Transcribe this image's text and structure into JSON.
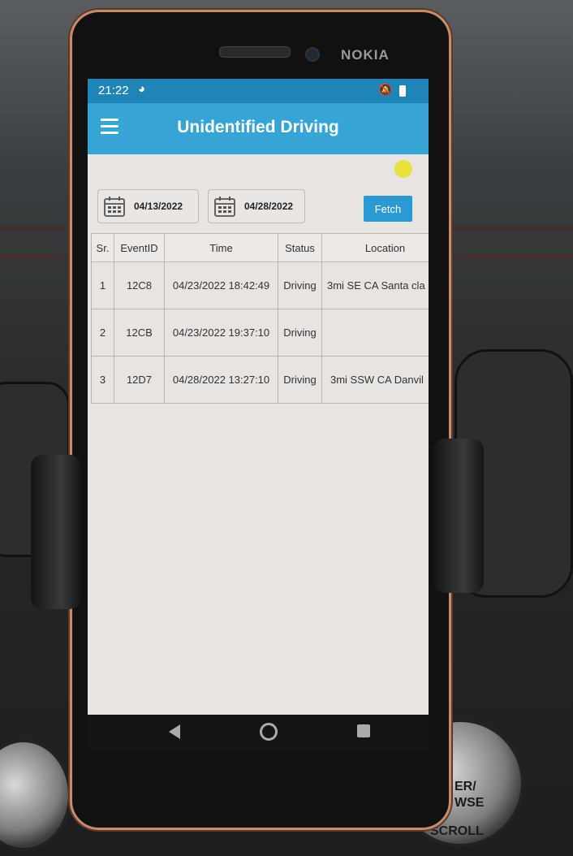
{
  "device": {
    "brand": "NOKIA"
  },
  "status_bar": {
    "time": "21:22",
    "sync_icon": "sync-icon",
    "mute_icon": "bell-off-icon",
    "battery_icon": "battery-icon"
  },
  "app_bar": {
    "title": "Unidentified Driving",
    "menu_icon": "hamburger-menu-icon"
  },
  "filters": {
    "start_date": "04/13/2022",
    "end_date": "04/28/2022",
    "fetch_label": "Fetch"
  },
  "table": {
    "headers": [
      "Sr.",
      "EventID",
      "Time",
      "Status",
      "Location"
    ],
    "rows": [
      [
        "1",
        "12C8",
        "04/23/2022 18:42:49",
        "Driving",
        "3mi SE CA Santa cla"
      ],
      [
        "2",
        "12CB",
        "04/23/2022 19:37:10",
        "Driving",
        ""
      ],
      [
        "3",
        "12D7",
        "04/28/2022 13:27:10",
        "Driving",
        "3mi SSW CA Danvil"
      ]
    ]
  },
  "background": {
    "knob_text": [
      "ER/",
      "WSE",
      "SCROLL"
    ]
  }
}
